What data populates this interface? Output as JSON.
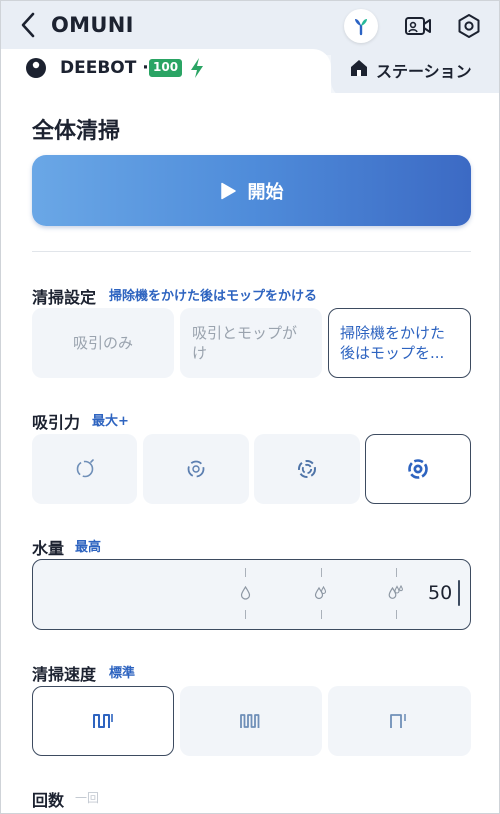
{
  "header": {
    "title": "OMUNI",
    "back_icon": "back-chevron-icon",
    "fan_icon": "fan-icon",
    "camera_icon": "video-camera-icon",
    "settings_icon": "gear-icon"
  },
  "robot": {
    "name": "DEEBOT ·",
    "battery": "100",
    "charging_icon": "lightning-icon"
  },
  "station": {
    "label": "ステーション",
    "icon": "home-icon"
  },
  "page_title": "全体清掃",
  "start_button": {
    "label": "開始",
    "icon": "play-icon"
  },
  "cleaning_mode": {
    "title": "清掃設定",
    "value": "掃除機をかけた後はモップをかける",
    "options": [
      {
        "label": "吸引のみ",
        "selected": false
      },
      {
        "label": "吸引とモップが\nけ",
        "selected": false
      },
      {
        "label": "掃除機をかけた\n後はモップを...",
        "selected": true
      }
    ]
  },
  "suction": {
    "title": "吸引力",
    "value": "最大+",
    "options": [
      {
        "name": "quiet",
        "icon": "suction-level-1-icon",
        "selected": false
      },
      {
        "name": "standard",
        "icon": "suction-level-2-icon",
        "selected": false
      },
      {
        "name": "max",
        "icon": "suction-level-3-icon",
        "selected": false
      },
      {
        "name": "max-plus",
        "icon": "suction-level-4-icon",
        "selected": true
      }
    ]
  },
  "water": {
    "title": "水量",
    "value": "最高",
    "level": "50"
  },
  "speed": {
    "title": "清掃速度",
    "value": "標準",
    "options": [
      {
        "name": "standard",
        "icon": "standard-path-icon",
        "selected": true
      },
      {
        "name": "deep",
        "icon": "deep-path-icon",
        "selected": false
      },
      {
        "name": "quick",
        "icon": "quick-path-icon",
        "selected": false
      }
    ]
  },
  "passes": {
    "title": "回数",
    "value": "一回"
  },
  "colors": {
    "accent": "#2e64c0",
    "battery": "#2aa464",
    "button_start": "#6aa7e6",
    "button_end": "#3c6ac4"
  }
}
